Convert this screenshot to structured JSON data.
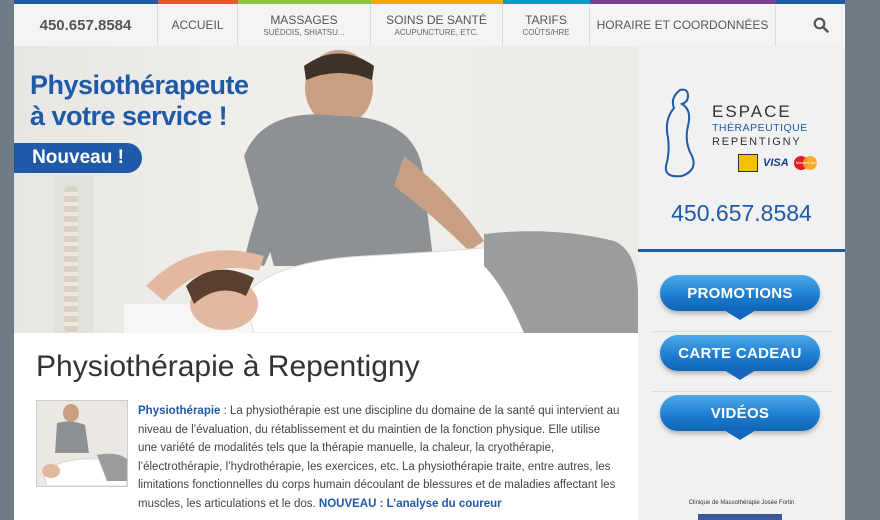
{
  "nav": {
    "phone": "450.657.8584",
    "items": [
      {
        "main": "ACCUEIL",
        "sub": ""
      },
      {
        "main": "MASSAGES",
        "sub": "SUÉDOIS, SHIATSU..."
      },
      {
        "main": "SOINS DE SANTÉ",
        "sub": "ACUPUNCTURE, ETC."
      },
      {
        "main": "TARIFS",
        "sub": "COÛTS/HRE"
      },
      {
        "main": "HORAIRE ET COORDONNÉES",
        "sub": ""
      }
    ],
    "search_icon": "search-icon",
    "stripe_colors": [
      "#1e5aa8",
      "#e35a2b",
      "#8cc63f",
      "#f2a900",
      "#00a0c6",
      "#7b3f98",
      "#1e5aa8"
    ]
  },
  "hero": {
    "headline_line1": "Physiothérapeute",
    "headline_line2": "à votre service !",
    "badge": "Nouveau !"
  },
  "sidebar": {
    "logo": {
      "line1": "ESPACE",
      "line2": "THÉRAPEUTIQUE",
      "line3": "REPENTIGNY",
      "card": "VISA",
      "card2": "MasterCard"
    },
    "phone": "450.657.8584",
    "buttons": [
      "PROMOTIONS",
      "CARTE CADEAU",
      "VIDÉOS"
    ],
    "clinic": "Clinique de Massothérapie Josée Fortin"
  },
  "content": {
    "title": "Physiothérapie à Repentigny",
    "lead": "Physiothérapie",
    "body": " : La physiothérapie est une discipline du domaine de la santé qui intervient au niveau de l’évaluation, du rétablissement et du maintien de la fonction physique. Elle utilise une variété de modalités tels que la thérapie manuelle, la chaleur, la cryothérapie, l’électrothérapie, l’hydrothérapie, les exercices, etc. La physiothérapie traite, entre autres, les limitations fonctionnelles du corps humain découlant de blessures et de maladies affectant les muscles, les articulations et le dos. ",
    "link": "NOUVEAU : L’analyse du coureur"
  },
  "colors": {
    "brand_blue": "#1e5aa8",
    "button_blue": "#1f7fd2"
  }
}
